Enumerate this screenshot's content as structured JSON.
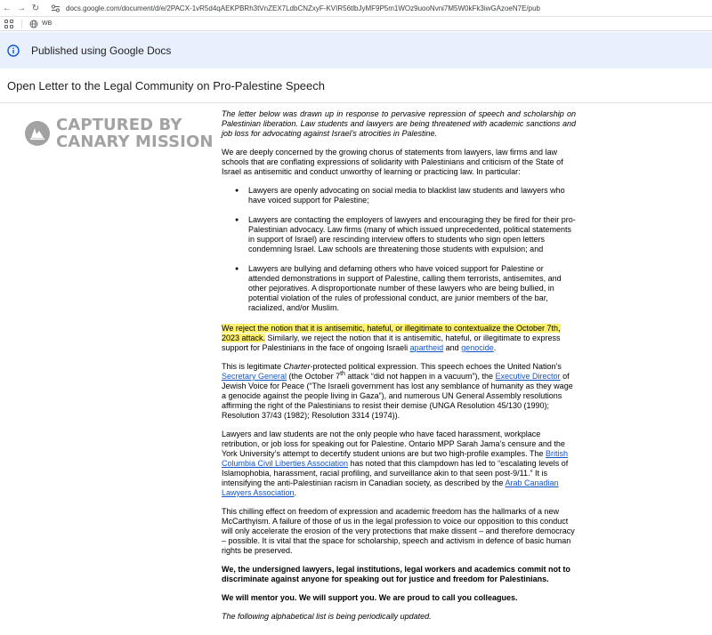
{
  "browser": {
    "url": "docs.google.com/document/d/e/2PACX-1vR5d4qAEKPBRh3tVnZEX7LdbCNZxyF-KVIR56tlbJyMF9P5m1WOz9uooNvni7M5W0kFk3iwGAzoeN7E/pub",
    "bookmark_label": "WB"
  },
  "banner": {
    "text": "Published using Google Docs"
  },
  "doc": {
    "title": "Open Letter to the Legal Community on Pro-Palestine Speech"
  },
  "watermark": {
    "line1": "CAPTURED BY",
    "line2": "CANARY MISSION"
  },
  "letter": {
    "intro": "The letter below was drawn up in response to pervasive repression of speech and scholarship on Palestinian liberation. Law students and lawyers are being threatened with academic sanctions and job loss for advocating against Israel’s atrocities in Palestine.",
    "p1": "We are deeply concerned by the growing chorus of statements from lawyers, law firms and law schools that are conflating expressions of solidarity with Palestinians and criticism of the State of Israel as antisemitic and conduct unworthy of learning or practicing law. In particular:",
    "bullets": [
      "Lawyers are openly advocating on social media to blacklist law students and lawyers who have voiced support for Palestine;",
      "Lawyers are contacting the employers of lawyers and encouraging they be fired for their pro-Palestinian advocacy. Law firms (many of which issued unprecedented, political statements in support of Israel) are rescinding interview offers to students who sign open letters condemning Israel. Law schools are threatening those students with expulsion; and",
      "Lawyers are bullying and defaming others who have voiced support for Palestine or attended demonstrations in support of Palestine, calling them terrorists, antisemites, and other pejoratives. A disproportionate number of these lawyers who are being bullied, in potential violation of the rules of professional conduct, are junior members of the bar, racialized, and/or Muslim."
    ],
    "p2_highlight": "We reject the notion that it is antisemitic, hateful, or illegitimate to contextualize the October 7th, 2023 attack.",
    "p2_rest": " Similarly, we reject the notion that it is antisemitic, hateful, or illegitimate to express support for Palestinians in the face of ongoing Israeli ",
    "p2_link1": "apartheid",
    "p2_and": " and ",
    "p2_link2": "genocide",
    "p2_end": ".",
    "p3_a": "This is legitimate ",
    "p3_charter": "Charter",
    "p3_b": "-protected political expression. This speech echoes the United Nation’s ",
    "p3_link1": "Secretary General",
    "p3_c": " (the October 7",
    "p3_sup": "th",
    "p3_d": " attack “did not happen in a vacuum”), the ",
    "p3_link2": "Executive Director",
    "p3_e": " of Jewish Voice for Peace (“The Israeli government has lost any semblance of humanity as they wage a genocide against the people living in Gaza”), and  numerous UN General Assembly resolutions affirming the right of the Palestinians to resist their demise (UNGA Resolution 45/130 (1990); Resolution 37/43 (1982); Resolution 3314 (1974)).",
    "p4_a": "Lawyers and law students are not the only people who have faced harassment, workplace retribution, or job loss for speaking out for Palestine. Ontario MPP Sarah Jama’s censure and the York University’s attempt to decertify student unions are but two high-profile examples. The ",
    "p4_link1": "British Columbia Civil Liberties Association",
    "p4_b": " has noted that this clampdown has led to “escalating levels of Islamophobia, harassment, racial profiling, and surveillance akin to that seen post-9/11.” It is intensifying the anti-Palestinian racism in Canadian society, as described by the ",
    "p4_link2": "Arab Canadian Lawyers Association",
    "p4_c": ".",
    "p5": "This chilling effect on freedom of expression and academic freedom has the hallmarks of a new McCarthyism. A failure of those of us in the legal profession to voice our opposition to this conduct will only accelerate the erosion of the very protections that make dissent – and therefore democracy – possible. It is vital that the space for scholarship, speech and activism in defence of basic human rights be preserved.",
    "p6": "We, the undersigned lawyers, legal institutions, legal workers and academics commit not to discriminate against anyone for speaking out for justice and freedom for Palestinians.",
    "p7": "We will mentor you. We will support you. We are proud to call you colleagues.",
    "p8": "The following alphabetical list is being periodically updated."
  },
  "colors": {
    "banner_bg": "#e8f0fe",
    "highlight": "#fdf06a",
    "link": "#1155cc",
    "watermark": "#a2a2a2"
  },
  "icons": [
    "back-arrow-icon",
    "forward-arrow-icon",
    "reload-icon",
    "site-settings-icon",
    "apps-grid-icon",
    "globe-icon",
    "info-icon",
    "canary-logo-icon"
  ]
}
